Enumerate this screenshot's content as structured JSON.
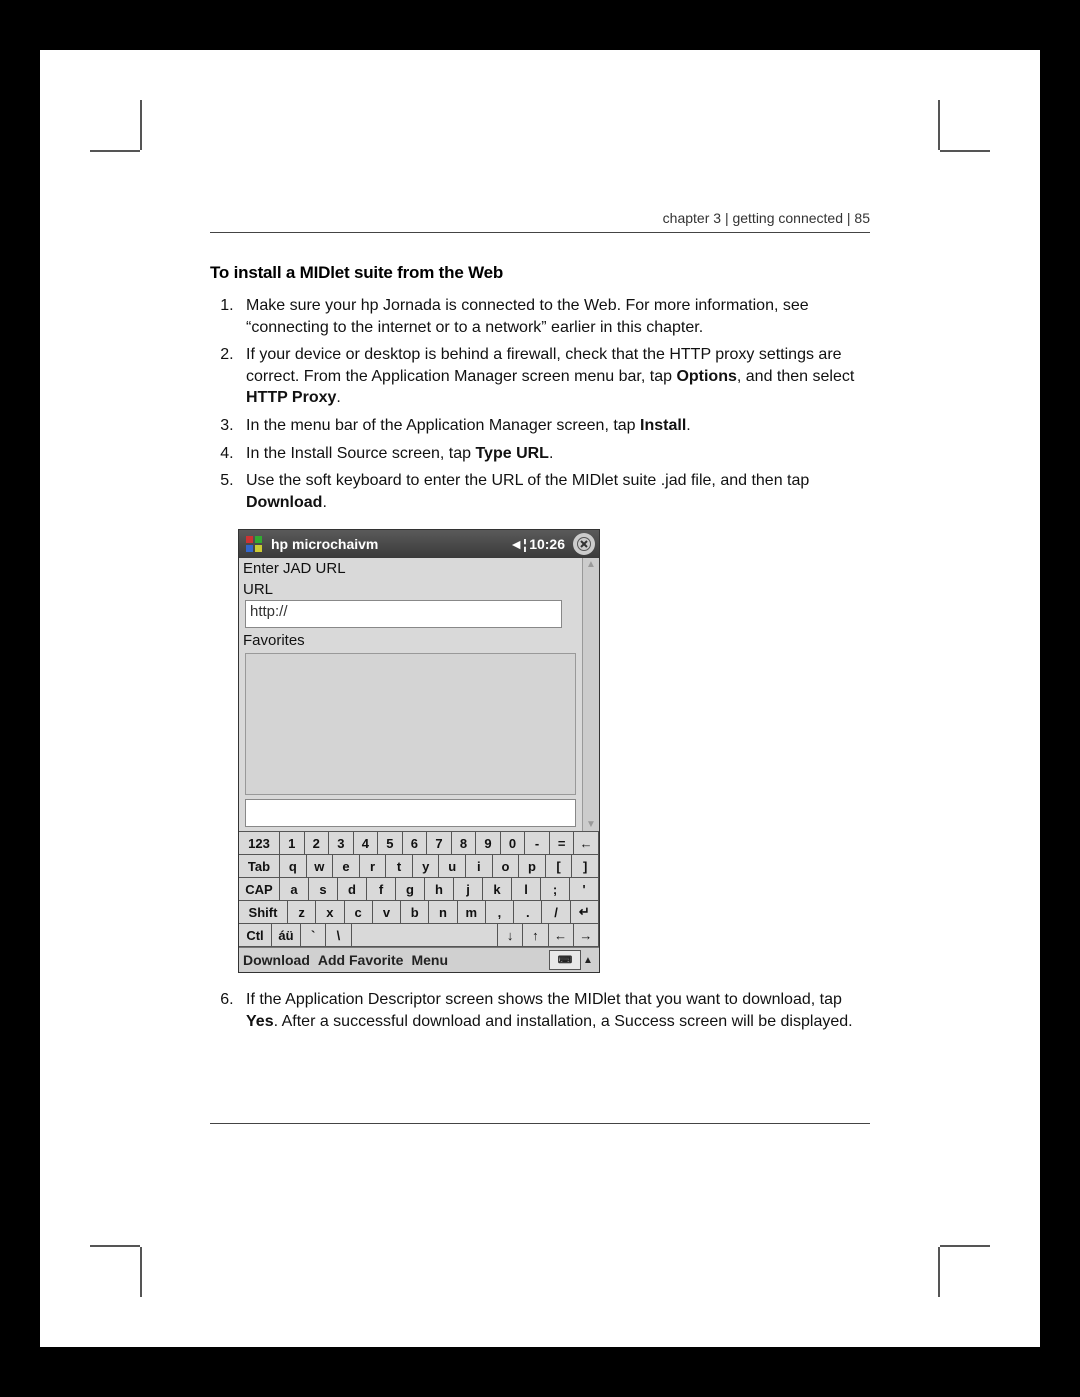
{
  "header": {
    "chapter": "chapter 3",
    "section": "getting connected",
    "page_num": "85"
  },
  "title": "To install a MIDlet suite from the Web",
  "steps_a": [
    {
      "pre": "Make sure your hp Jornada is connected to the Web. For more information, see “connecting to the internet or to a network” earlier in this chapter."
    },
    {
      "pre": "If your device or desktop is behind a firewall, check that the HTTP proxy settings are correct. From the Application Manager screen menu bar, tap ",
      "b1": "Options",
      "mid": ", and then select ",
      "b2": "HTTP Proxy",
      "post": "."
    },
    {
      "pre": "In the menu bar of the Application Manager screen, tap ",
      "b1": "Install",
      "post": "."
    },
    {
      "pre": "In the Install Source screen, tap ",
      "b1": "Type URL",
      "post": "."
    },
    {
      "pre": "Use the soft keyboard to enter the URL of the MIDlet suite .jad file, and then tap ",
      "b1": "Download",
      "post": "."
    }
  ],
  "steps_b": [
    {
      "pre": "If the Application Descriptor screen shows the MIDlet that you want to download, tap ",
      "b1": "Yes",
      "post": ". After a successful download and installation, a Success screen will be displayed."
    }
  ],
  "device": {
    "app_name": "hp microchaivm",
    "time": "10:26",
    "close_glyph": "⊗",
    "snd_glyph": "◄¦",
    "enter_label": "Enter JAD URL",
    "url_label": "URL",
    "url_value": "http://",
    "fav_label": "Favorites",
    "menu": {
      "download": "Download",
      "addfav": "Add Favorite",
      "menu": "Menu"
    },
    "kbd": {
      "r1": [
        "123",
        "1",
        "2",
        "3",
        "4",
        "5",
        "6",
        "7",
        "8",
        "9",
        "0",
        "-",
        "=",
        "←"
      ],
      "r2": [
        "Tab",
        "q",
        "w",
        "e",
        "r",
        "t",
        "y",
        "u",
        "i",
        "o",
        "p",
        "[",
        "]"
      ],
      "r3": [
        "CAP",
        "a",
        "s",
        "d",
        "f",
        "g",
        "h",
        "j",
        "k",
        "l",
        ";",
        "'"
      ],
      "r4": [
        "Shift",
        "z",
        "x",
        "c",
        "v",
        "b",
        "n",
        "m",
        ",",
        ".",
        "/",
        "↵"
      ],
      "r5": [
        "Ctl",
        "áü",
        "`",
        "\\",
        "",
        "↓",
        "↑",
        "←",
        "→"
      ]
    }
  }
}
